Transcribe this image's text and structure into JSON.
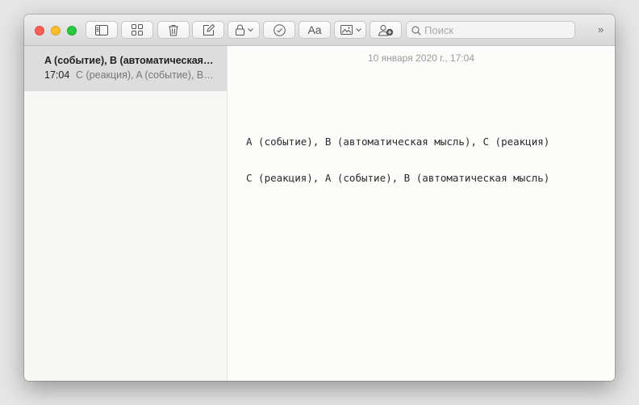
{
  "toolbar": {
    "buttons": [
      {
        "id": "sidebar",
        "icon": "sidebar-toggle-icon"
      },
      {
        "id": "gallery",
        "icon": "gallery-grid-icon"
      },
      {
        "id": "delete",
        "icon": "trash-icon"
      },
      {
        "id": "compose",
        "icon": "compose-icon"
      },
      {
        "id": "lock",
        "icon": "lock-icon"
      },
      {
        "id": "checklist",
        "icon": "checklist-icon"
      },
      {
        "id": "format",
        "icon": "format-text-icon",
        "label": "Aa"
      },
      {
        "id": "media",
        "icon": "media-icon"
      },
      {
        "id": "collaborate",
        "icon": "add-people-icon"
      }
    ],
    "search": {
      "placeholder": "Поиск",
      "value": ""
    },
    "overflow_label": "»"
  },
  "sidebar": {
    "notes": [
      {
        "title": "A (событие), B (автоматическая мысль), C (реакция)",
        "time": "17:04",
        "preview": "C (реакция), A (событие), B (автоматическая мысль)",
        "selected": true
      }
    ]
  },
  "editor": {
    "date": "10 января 2020 г., 17:04",
    "lines": [
      "A (событие), B (автоматическая мысль), C (реакция)",
      "C (реакция), A (событие), B (автоматическая мысль)"
    ]
  },
  "colors": {
    "selection": "#dddddd",
    "close": "#fd5f57",
    "minimize": "#febc2e",
    "zoom": "#28c840"
  }
}
